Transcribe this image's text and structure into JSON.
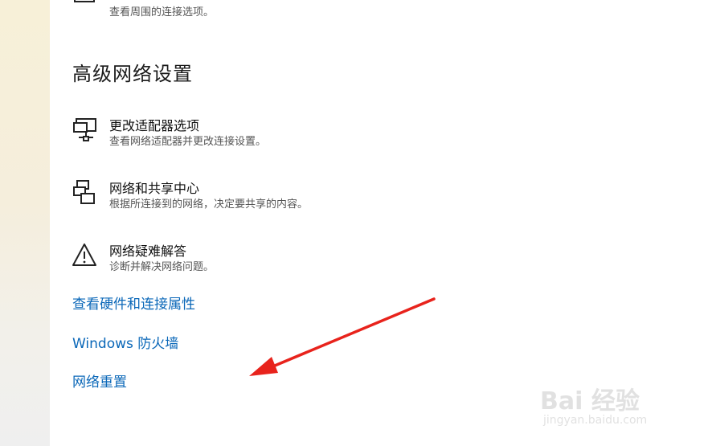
{
  "top_item": {
    "desc": "查看周围的连接选项。"
  },
  "section": {
    "title": "高级网络设置"
  },
  "items": [
    {
      "icon": "monitor-network-icon",
      "title": "更改适配器选项",
      "desc": "查看网络适配器并更改连接设置。"
    },
    {
      "icon": "network-sharing-icon",
      "title": "网络和共享中心",
      "desc": "根据所连接到的网络，决定要共享的内容。"
    },
    {
      "icon": "warning-triangle-icon",
      "title": "网络疑难解答",
      "desc": "诊断并解决网络问题。"
    }
  ],
  "links": [
    {
      "label": "查看硬件和连接属性"
    },
    {
      "label": "Windows 防火墙"
    },
    {
      "label": "网络重置"
    }
  ],
  "annotation": {
    "arrow_color": "#e8231c"
  },
  "watermark": {
    "brand": "Bai 经验",
    "url": "jingyan.baidu.com"
  },
  "colors": {
    "link": "#0a67b8",
    "sidebar": "#f7f0d8"
  }
}
